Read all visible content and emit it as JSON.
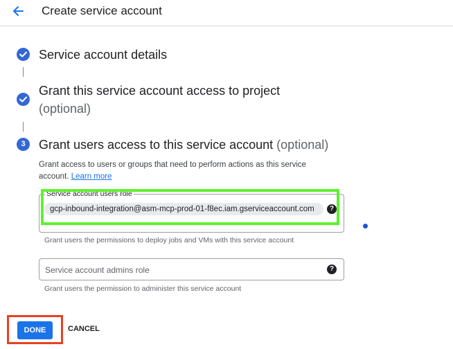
{
  "header": {
    "title": "Create service account",
    "back_icon": "arrow-left-icon"
  },
  "steps": [
    {
      "title": "Service account details",
      "status": "complete"
    },
    {
      "title": "Grant this service account access to project",
      "optional": "(optional)",
      "status": "complete"
    },
    {
      "number": "3",
      "title": "Grant users access to this service account",
      "optional": "(optional)",
      "status": "active"
    }
  ],
  "description": {
    "text": "Grant access to users or groups that need to perform actions as this service account.",
    "link": "Learn more"
  },
  "users_role": {
    "label": "Service account users role",
    "chip_value": "gcp-inbound-integration@asm-mcp-prod-01-f8ec.iam.gserviceaccount.com",
    "help_icon": "?",
    "hint": "Grant users the permissions to deploy jobs and VMs with this service account"
  },
  "admins_role": {
    "placeholder": "Service account admins role",
    "help_icon": "?",
    "hint": "Grant users the permission to administer this service account"
  },
  "actions": {
    "done": "DONE",
    "cancel": "CANCEL"
  },
  "colors": {
    "accent": "#1a73e8",
    "step_blue": "#3367d6",
    "highlight_green": "#5ef22f",
    "highlight_red": "#e8401c"
  }
}
